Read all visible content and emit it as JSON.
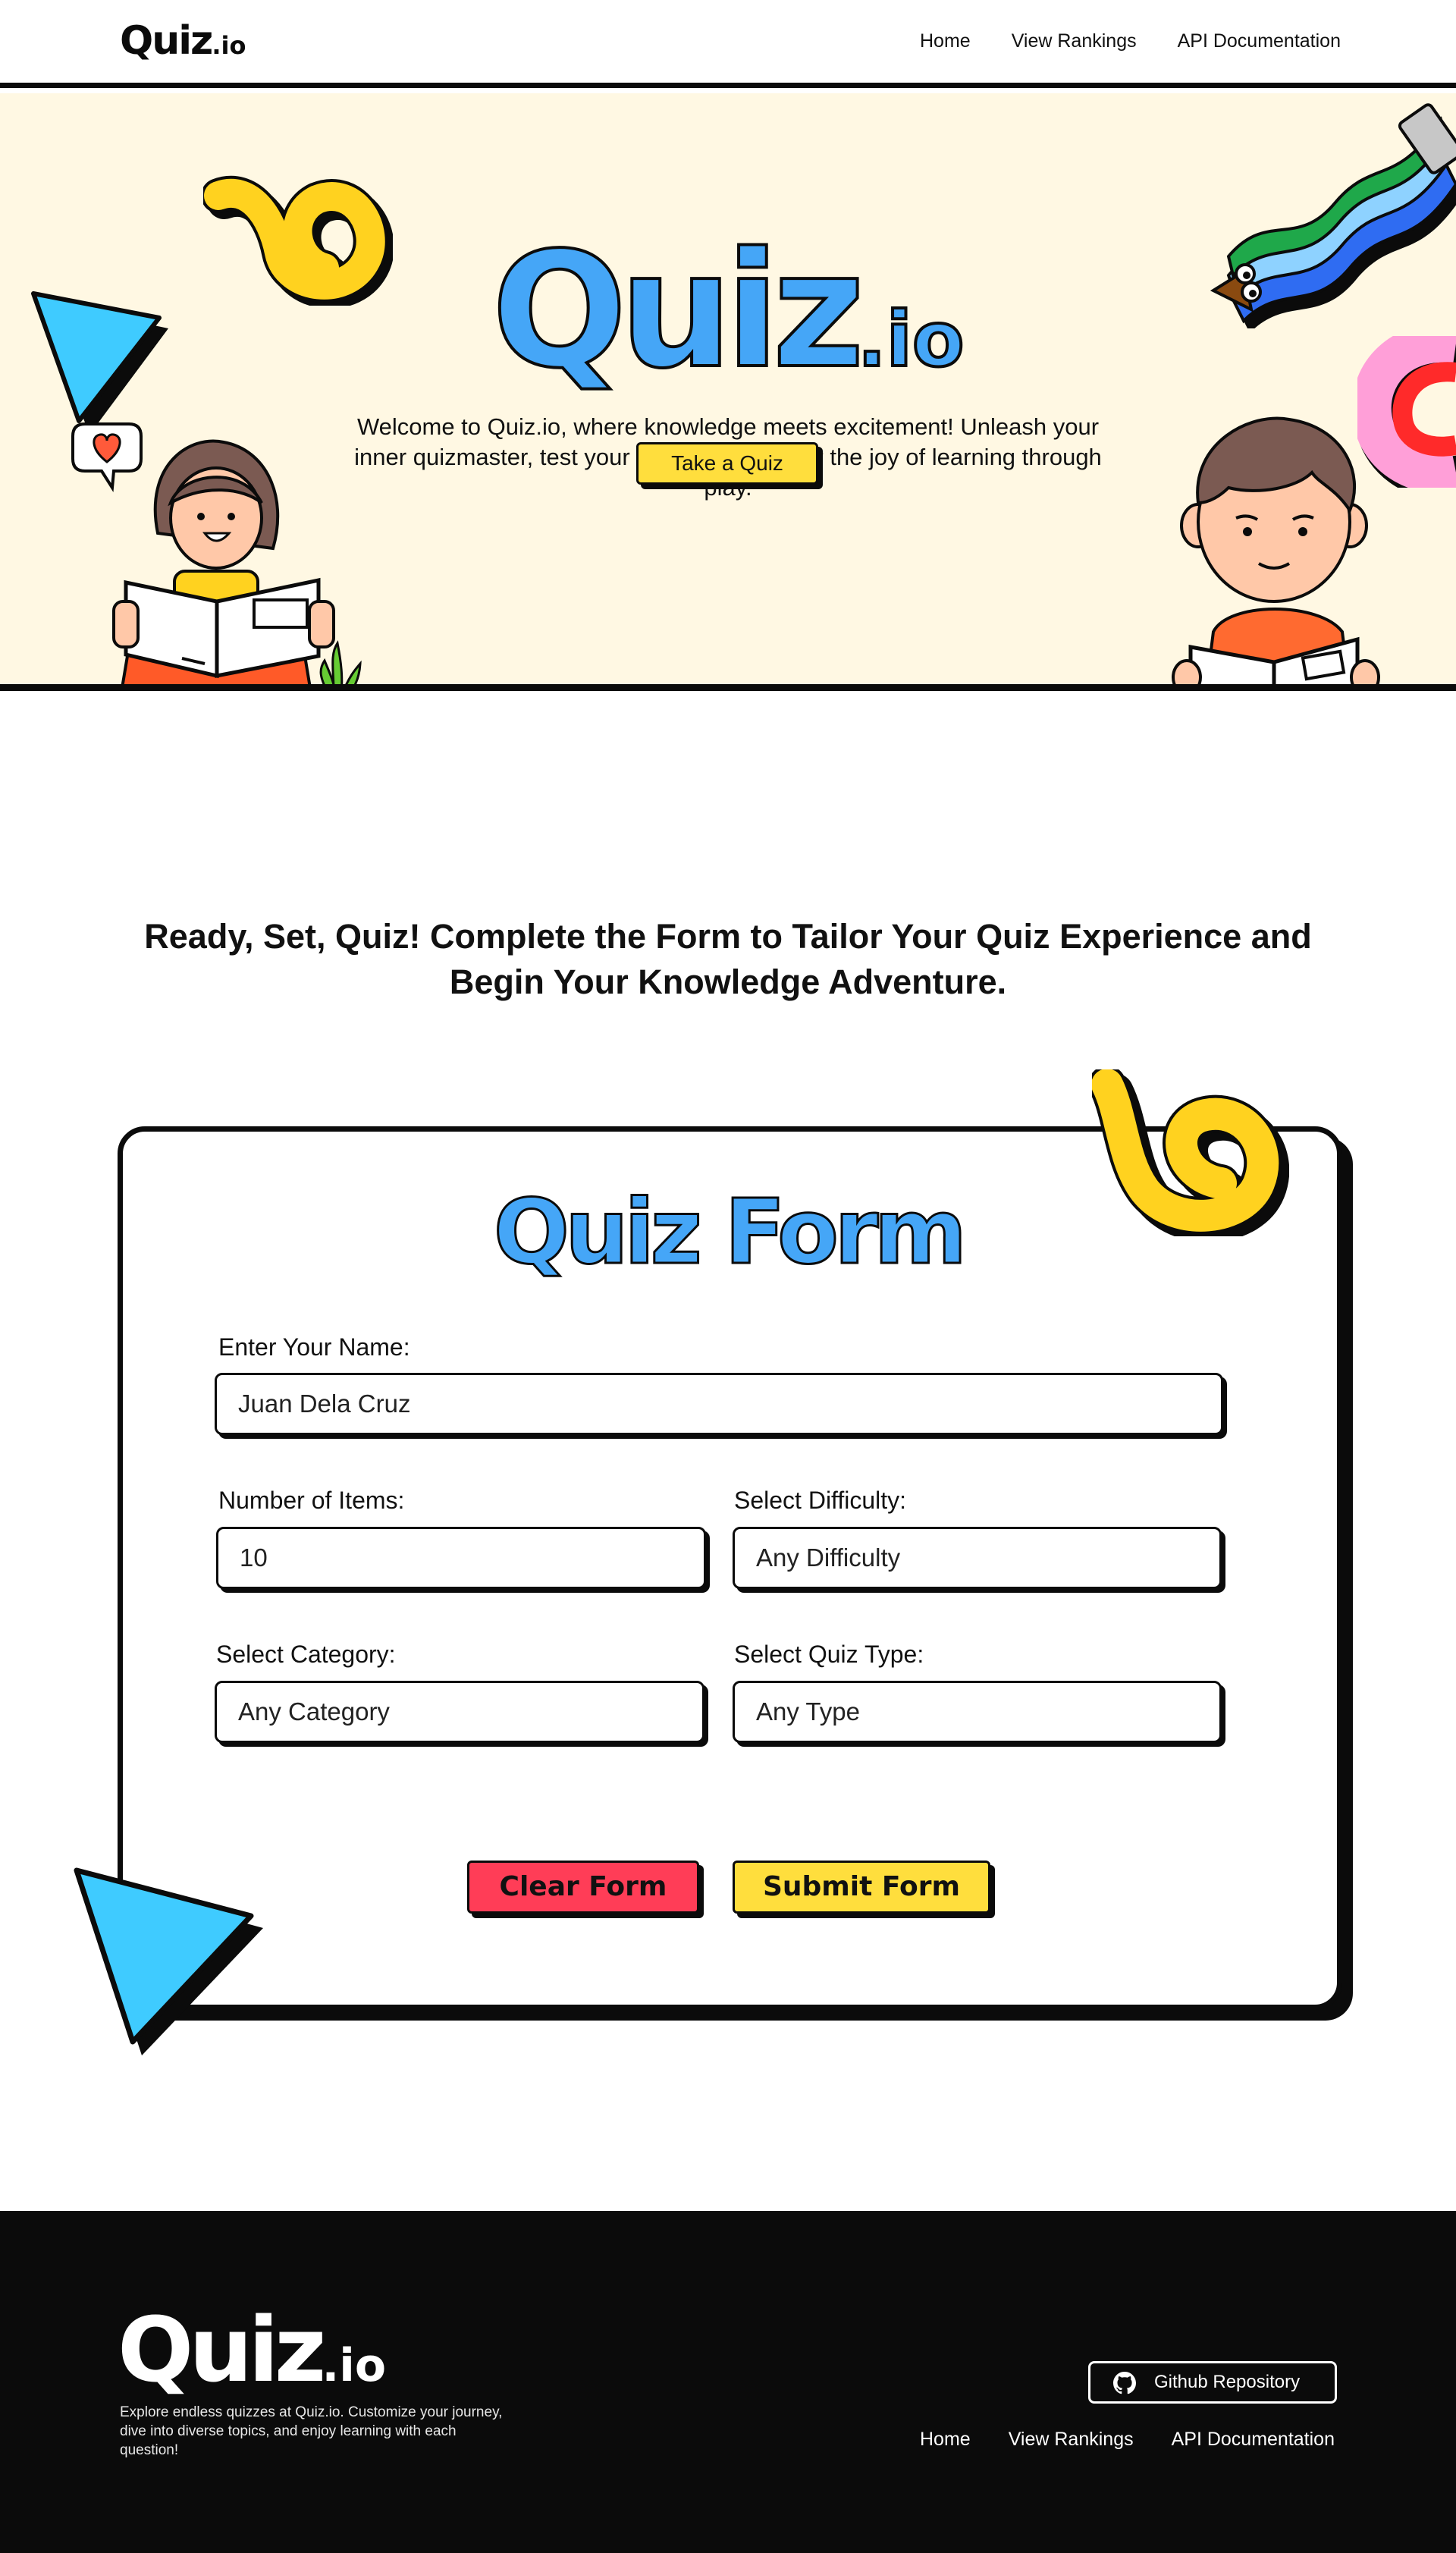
{
  "header": {
    "logo_main": "Quiz",
    "logo_suffix": ".io",
    "nav": [
      "Home",
      "View Rankings",
      "API Documentation"
    ]
  },
  "hero": {
    "title_main": "Quiz",
    "title_suffix": ".io",
    "description": "Welcome to Quiz.io, where knowledge meets excitement! Unleash your inner quizmaster, test your wits, and discover the joy of learning through play.",
    "cta_label": "Take a Quiz"
  },
  "intro": {
    "heading": "Ready, Set, Quiz! Complete the Form to Tailor Your Quiz Experience and Begin Your Knowledge Adventure."
  },
  "form": {
    "title": "Quiz Form",
    "name": {
      "label": "Enter  Your Name:",
      "value": "Juan Dela Cruz"
    },
    "items": {
      "label": "Number of Items:",
      "value": "10"
    },
    "difficulty": {
      "label": "Select Difficulty:",
      "value": "Any Difficulty"
    },
    "category": {
      "label": "Select Category:",
      "value": "Any Category"
    },
    "type": {
      "label": "Select Quiz Type:",
      "value": "Any Type"
    },
    "clear_label": "Clear Form",
    "submit_label": "Submit Form"
  },
  "footer": {
    "logo_main": "Quiz",
    "logo_suffix": ".io",
    "description": "Explore endless quizzes at Quiz.io. Customize your journey, dive into diverse topics, and enjoy learning with each question!",
    "github_label": "Github Repository",
    "nav": [
      "Home",
      "View Rankings",
      "API Documentation"
    ]
  },
  "colors": {
    "accent_blue": "#45a6f7",
    "accent_yellow": "#ffde3d",
    "accent_red": "#ff3d57",
    "hero_bg": "#fff8e3",
    "ink": "#0b0b0b"
  },
  "icons": [
    "github-icon",
    "heart-icon"
  ]
}
